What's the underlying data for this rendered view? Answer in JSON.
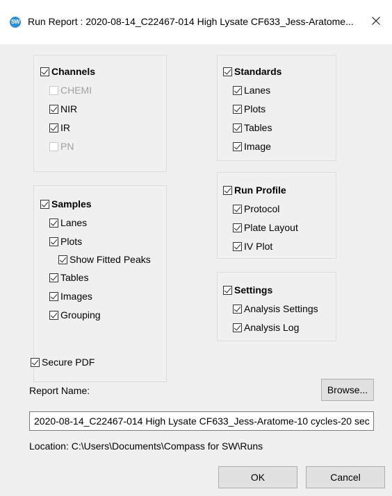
{
  "window": {
    "icon_text": "SW",
    "title": "Run Report : 2020-08-14_C22467-014 High Lysate CF633_Jess-Aratome..."
  },
  "channels": {
    "label": "Channels",
    "checked": true,
    "items": [
      {
        "label": "CHEMI",
        "checked": false,
        "disabled": true
      },
      {
        "label": "NIR",
        "checked": true,
        "disabled": false
      },
      {
        "label": "IR",
        "checked": true,
        "disabled": false
      },
      {
        "label": "PN",
        "checked": false,
        "disabled": true
      }
    ]
  },
  "standards": {
    "label": "Standards",
    "checked": true,
    "items": [
      {
        "label": "Lanes",
        "checked": true
      },
      {
        "label": "Plots",
        "checked": true
      },
      {
        "label": "Tables",
        "checked": true
      },
      {
        "label": "Image",
        "checked": true
      }
    ]
  },
  "samples": {
    "label": "Samples",
    "checked": true,
    "items": [
      {
        "label": "Lanes",
        "checked": true
      },
      {
        "label": "Plots",
        "checked": true
      },
      {
        "label": "Show Fitted Peaks",
        "checked": true
      },
      {
        "label": "Tables",
        "checked": true
      },
      {
        "label": "Images",
        "checked": true
      },
      {
        "label": "Grouping",
        "checked": true
      }
    ]
  },
  "run_profile": {
    "label": "Run Profile",
    "checked": true,
    "items": [
      {
        "label": "Protocol",
        "checked": true
      },
      {
        "label": "Plate Layout",
        "checked": true
      },
      {
        "label": "IV Plot",
        "checked": true
      }
    ]
  },
  "settings": {
    "label": "Settings",
    "checked": true,
    "items": [
      {
        "label": "Analysis Settings",
        "checked": true
      },
      {
        "label": "Analysis Log",
        "checked": true
      }
    ]
  },
  "secure_pdf": {
    "label": "Secure PDF",
    "checked": true
  },
  "report_name": {
    "label": "Report Name:",
    "value": "2020-08-14_C22467-014 High Lysate CF633_Jess-Aratome-10 cycles-20 sec"
  },
  "browse_label": "Browse...",
  "location": "Location: C:\\Users\\Documents\\Compass for SW\\Runs",
  "ok_label": "OK",
  "cancel_label": "Cancel"
}
